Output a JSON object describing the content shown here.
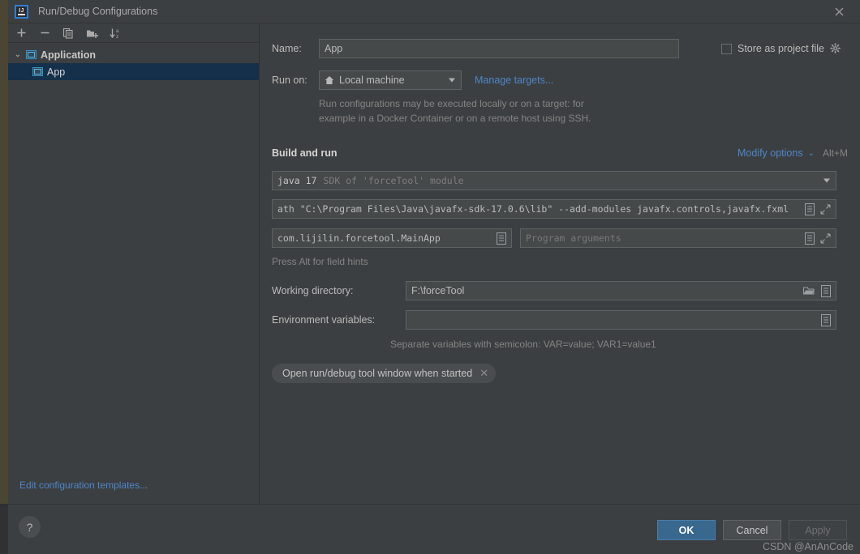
{
  "window": {
    "title": "Run/Debug Configurations",
    "app_icon": "intellij-idea-logo",
    "close_icon": "close-icon"
  },
  "sidebar": {
    "toolbar": [
      {
        "name": "add-configuration-button",
        "icon": "plus-icon",
        "glyph": "+"
      },
      {
        "name": "remove-configuration-button",
        "icon": "minus-icon",
        "glyph": "−"
      },
      {
        "name": "copy-configuration-button",
        "icon": "copy-icon",
        "glyph": "⧉"
      },
      {
        "name": "new-folder-button",
        "icon": "folder-add-icon",
        "glyph": "📁"
      },
      {
        "name": "sort-configurations-button",
        "icon": "sort-alphabetical-icon",
        "glyph": "↓"
      }
    ],
    "tree": {
      "group_label": "Application",
      "group_chevron": "⌄",
      "selected_item": "App"
    },
    "edit_templates_link": "Edit configuration templates..."
  },
  "form": {
    "name_label": "Name:",
    "name_value": "App",
    "store_as_project_file_label": "Store as project file",
    "store_as_project_file_checked": false,
    "store_gear_icon": "gear-icon",
    "run_on_label": "Run on:",
    "run_on_value": "Local machine",
    "run_on_icon": "home-icon",
    "manage_targets_link": "Manage targets...",
    "hint_line_1": "Run configurations may be executed locally or on a target: for",
    "hint_line_2": "example in a Docker Container or on a remote host using SSH.",
    "build_and_run_title": "Build and run",
    "modify_options_link": "Modify options",
    "modify_options_chevron": "⌄",
    "modify_options_shortcut": "Alt+M",
    "jdk_value": "java 17",
    "jdk_description": "SDK of 'forceTool' module",
    "vm_options_value": "ath \"C:\\Program Files\\Java\\javafx-sdk-17.0.6\\lib\" --add-modules javafx.controls,javafx.fxml",
    "main_class_value": "com.lijilin.forcetool.MainApp",
    "program_arguments_placeholder": "Program arguments",
    "field_hint": "Press Alt for field hints",
    "working_directory_label": "Working directory:",
    "working_directory_value": "F:\\forceTool",
    "environment_variables_label": "Environment variables:",
    "environment_variables_value": "",
    "environment_hint": "Separate variables with semicolon: VAR=value; VAR1=value1",
    "chip_label": "Open run/debug tool window when started",
    "chip_close_icon": "close-icon",
    "macro_icon": "insert-macro-icon",
    "expand_icon": "expand-editor-icon",
    "browse_icon": "browse-folder-icon"
  },
  "footer": {
    "help_label": "?",
    "ok_label": "OK",
    "cancel_label": "Cancel",
    "apply_label": "Apply",
    "apply_enabled": false,
    "watermark": "CSDN @AnAnCode"
  },
  "colors": {
    "background": "#3c3f41",
    "field_background": "#45494a",
    "link": "#4d86c9",
    "selection": "#14304a",
    "primary_button": "#39688f",
    "accent_icon": "#3a92c5"
  }
}
